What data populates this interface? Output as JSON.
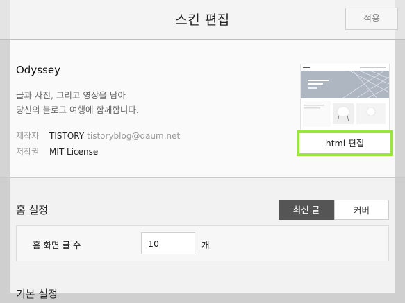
{
  "header": {
    "title": "스킨 편집",
    "apply_label": "적용"
  },
  "skin": {
    "name": "Odyssey",
    "description_line1": "글과 사진, 그리고 영상을 담아",
    "description_line2": "당신의 블로그 여행에 함께합니다.",
    "maker_label": "제작자",
    "maker_value": "TISTORY",
    "maker_email": "tistoryblog@daum.net",
    "license_label": "저작권",
    "license_value": "MIT License",
    "html_edit_label": "html 편집"
  },
  "home_settings": {
    "title": "홈 설정",
    "tabs": [
      {
        "label": "최신 글",
        "active": true
      },
      {
        "label": "커버",
        "active": false
      }
    ],
    "post_count_label": "홈 화면 글 수",
    "post_count_value": "10",
    "post_count_unit": "개"
  },
  "basic_settings": {
    "title": "기본 설정"
  },
  "colors": {
    "highlight": "#9be63c",
    "active_tab": "#555555"
  }
}
